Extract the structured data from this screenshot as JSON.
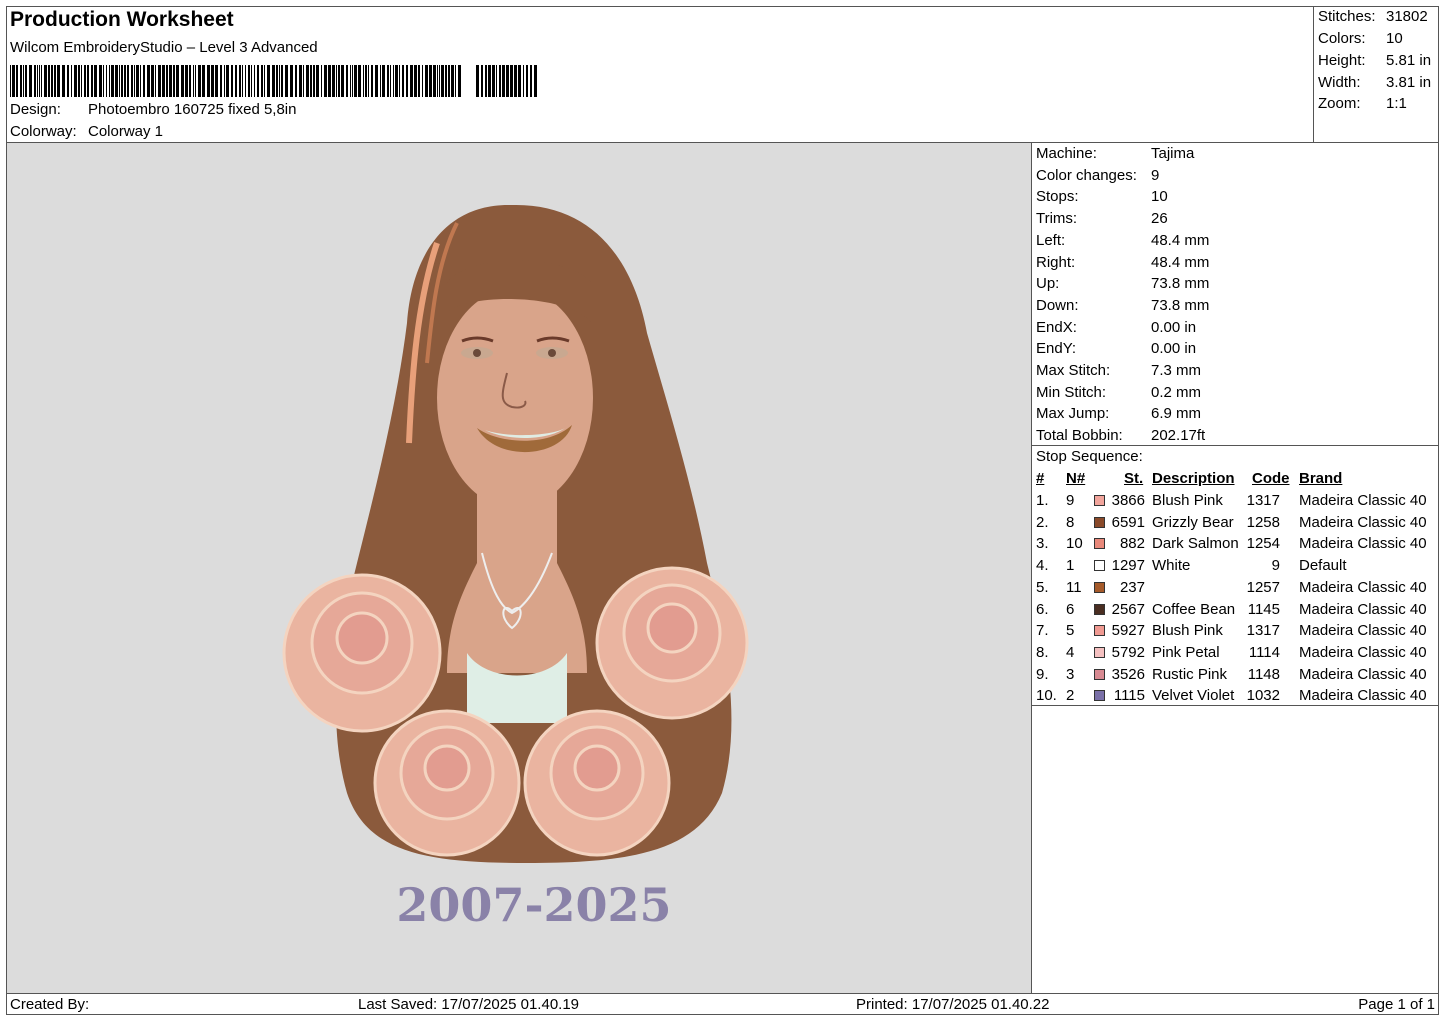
{
  "header": {
    "title": "Production Worksheet",
    "subtitle": "Wilcom EmbroideryStudio – Level 3 Advanced",
    "design_label": "Design:",
    "design_value": "Photoembro 160725 fixed 5,8in",
    "colorway_label": "Colorway:",
    "colorway_value": "Colorway 1"
  },
  "stats": [
    {
      "label": "Stitches:",
      "value": "31802"
    },
    {
      "label": "Colors:",
      "value": "10"
    },
    {
      "label": "Height:",
      "value": "5.81 in"
    },
    {
      "label": "Width:",
      "value": "3.81 in"
    },
    {
      "label": "Zoom:",
      "value": "1:1"
    }
  ],
  "machine": [
    {
      "label": "Machine:",
      "value": "Tajima"
    },
    {
      "label": "Color changes:",
      "value": "9"
    },
    {
      "label": "Stops:",
      "value": "10"
    },
    {
      "label": "Trims:",
      "value": "26"
    },
    {
      "label": "Left:",
      "value": "48.4 mm"
    },
    {
      "label": "Right:",
      "value": "48.4 mm"
    },
    {
      "label": "Up:",
      "value": "73.8 mm"
    },
    {
      "label": "Down:",
      "value": "73.8 mm"
    },
    {
      "label": "EndX:",
      "value": "0.00 in"
    },
    {
      "label": "EndY:",
      "value": "0.00 in"
    },
    {
      "label": "Max Stitch:",
      "value": "7.3 mm"
    },
    {
      "label": "Min Stitch:",
      "value": "0.2 mm"
    },
    {
      "label": "Max Jump:",
      "value": "6.9 mm"
    },
    {
      "label": "Total Bobbin:",
      "value": "202.17ft"
    }
  ],
  "sequence": {
    "title": "Stop Sequence:",
    "columns": {
      "idx": "#",
      "n": "N#",
      "st": "St.",
      "desc": "Description",
      "code": "Code",
      "brand": "Brand"
    },
    "rows": [
      {
        "idx": "1.",
        "n": "9",
        "color": "#f2a59c",
        "st": "3866",
        "desc": "Blush Pink",
        "code": "1317",
        "brand": "Madeira Classic 40"
      },
      {
        "idx": "2.",
        "n": "8",
        "color": "#8a4a2a",
        "st": "6591",
        "desc": "Grizzly Bear",
        "code": "1258",
        "brand": "Madeira Classic 40"
      },
      {
        "idx": "3.",
        "n": "10",
        "color": "#e8887a",
        "st": "882",
        "desc": "Dark Salmon",
        "code": "1254",
        "brand": "Madeira Classic 40"
      },
      {
        "idx": "4.",
        "n": "1",
        "color": "#ffffff",
        "st": "1297",
        "desc": "White",
        "code": "9",
        "brand": "Default"
      },
      {
        "idx": "5.",
        "n": "11",
        "color": "#a55a2a",
        "st": "237",
        "desc": "",
        "code": "1257",
        "brand": "Madeira Classic 40"
      },
      {
        "idx": "6.",
        "n": "6",
        "color": "#4a2e22",
        "st": "2567",
        "desc": "Coffee Bean",
        "code": "1145",
        "brand": "Madeira Classic 40"
      },
      {
        "idx": "7.",
        "n": "5",
        "color": "#f09a92",
        "st": "5927",
        "desc": "Blush Pink",
        "code": "1317",
        "brand": "Madeira Classic 40"
      },
      {
        "idx": "8.",
        "n": "4",
        "color": "#f4c0c0",
        "st": "5792",
        "desc": "Pink Petal",
        "code": "1114",
        "brand": "Madeira Classic 40"
      },
      {
        "idx": "9.",
        "n": "3",
        "color": "#d88a92",
        "st": "3526",
        "desc": "Rustic Pink",
        "code": "1148",
        "brand": "Madeira Classic 40"
      },
      {
        "idx": "10.",
        "n": "2",
        "color": "#7a70a8",
        "st": "1115",
        "desc": "Velvet Violet",
        "code": "1032",
        "brand": "Madeira Classic 40"
      }
    ]
  },
  "preview": {
    "caption": "2007-2025",
    "colors": {
      "background": "#dcdcdc",
      "hair": "#8b5a3c",
      "skin": "#d9a48a",
      "rose": "#eab4a0",
      "text": "#8a82a8"
    }
  },
  "footer": {
    "created_by": "Created By:",
    "last_saved": "Last Saved: 17/07/2025 01.40.19",
    "printed": "Printed: 17/07/2025 01.40.22",
    "page": "Page 1 of 1"
  }
}
